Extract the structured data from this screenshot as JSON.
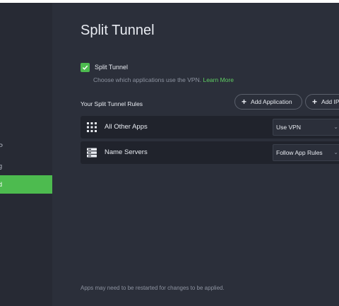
{
  "page": {
    "title": "Split Tunnel"
  },
  "sidebar": {
    "items": [
      {
        "label": "P",
        "active": false
      },
      {
        "label": "g",
        "active": false
      },
      {
        "label": "d",
        "active": true
      }
    ],
    "accent": "#4dbb4f"
  },
  "split_tunnel": {
    "label": "Split Tunnel",
    "checked": true,
    "description": "Choose which applications use the VPN.",
    "learn_more": "Learn More"
  },
  "rules": {
    "heading": "Your Split Tunnel Rules",
    "add_application": "Add Application",
    "add_ip": "Add IP",
    "items": [
      {
        "name": "All Other Apps",
        "icon": "grid-icon",
        "mode": "Use VPN"
      },
      {
        "name": "Name Servers",
        "icon": "server-icon",
        "mode": "Follow App Rules"
      }
    ]
  },
  "footer": {
    "note": "Apps may need to be restarted for changes to be applied."
  }
}
